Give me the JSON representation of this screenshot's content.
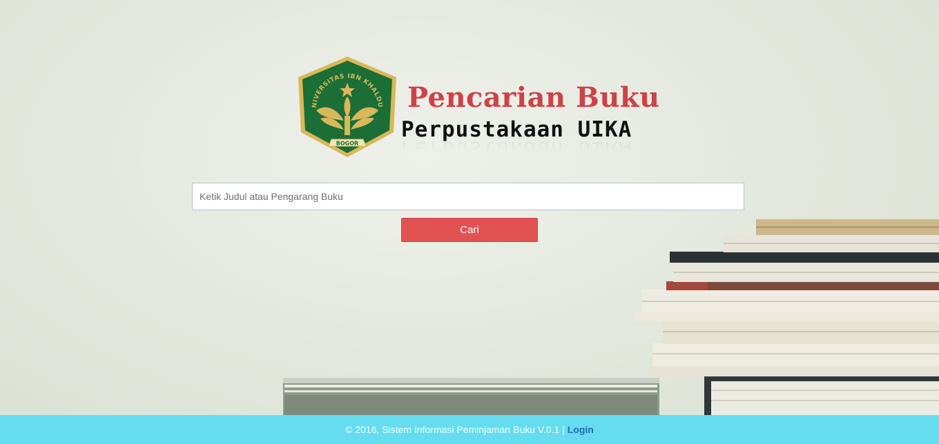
{
  "header": {
    "title": "Pencarian Buku",
    "subtitle": "Perpustakaan UIKA",
    "logo": {
      "ring_text": "UNIVERSITAS IBN KHALDUN",
      "ribbon_text": "BOGOR",
      "colors": {
        "shield": "#1b6e35",
        "gold": "#d8b85a"
      }
    }
  },
  "search": {
    "placeholder": "Ketik Judul atau Pengarang Buku",
    "value": "",
    "button_label": "Cari"
  },
  "footer": {
    "copyright": "© 2016, Sistem Informasi Peminjaman Buku V.0.1 |",
    "login_label": "Login"
  },
  "colors": {
    "title": "#cf4146",
    "button": "#e25253",
    "footer_bg": "#65dcef",
    "login_link": "#2a67b8"
  }
}
